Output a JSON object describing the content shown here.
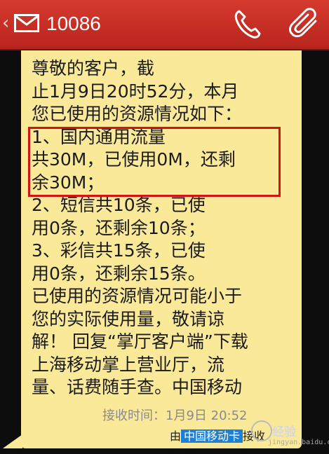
{
  "header": {
    "back_icon": "chevron-left-icon",
    "message_icon": "envelope-icon",
    "sender": "10086",
    "call_icon": "phone-icon",
    "attach_icon": "paperclip-icon",
    "color": "#c8302a"
  },
  "message": {
    "lines": [
      "尊敬的客户，截",
      "止1月9日20时52分，本月",
      "您已使用的资源情况如下：",
      "1、国内通用流量",
      "共30M，已使用0M，还剩",
      "余30M；",
      "2、短信共10条，已使",
      "用0条，还剩余10条；",
      "3、彩信共15条，已使",
      "用0条，还剩余15条。",
      "已使用的资源情况可能小于",
      "您的实际使用量，敬请谅",
      "解！ 回复“掌厅客户端”下载",
      "上海移动掌上营业厅，流",
      "量、话费随手查。中国移动"
    ],
    "bubble_color": "#fbe99a",
    "highlight_color": "#d11515"
  },
  "footer": {
    "received_time": "接收时间：1月9日 20:52",
    "via_prefix": "由",
    "sim_name": "中国移动卡",
    "via_suffix": "接收"
  },
  "watermark": {
    "text": "经验",
    "url": "jingyan.baidu.com"
  }
}
